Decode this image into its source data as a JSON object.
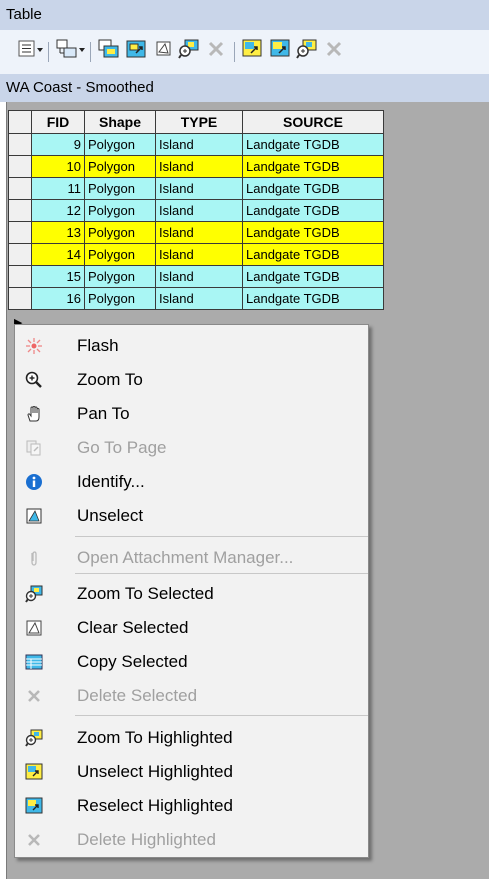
{
  "window": {
    "title": "Table"
  },
  "layer": {
    "name": "WA Coast - Smoothed"
  },
  "table": {
    "columns": [
      "FID",
      "Shape",
      "TYPE",
      "SOURCE"
    ],
    "rows": [
      {
        "fid": "9",
        "shape": "Polygon",
        "type": "Island",
        "source": "Landgate TGDB",
        "highlight": "cyan"
      },
      {
        "fid": "10",
        "shape": "Polygon",
        "type": "Island",
        "source": "Landgate TGDB",
        "highlight": "yellow"
      },
      {
        "fid": "11",
        "shape": "Polygon",
        "type": "Island",
        "source": "Landgate TGDB",
        "highlight": "cyan"
      },
      {
        "fid": "12",
        "shape": "Polygon",
        "type": "Island",
        "source": "Landgate TGDB",
        "highlight": "cyan"
      },
      {
        "fid": "13",
        "shape": "Polygon",
        "type": "Island",
        "source": "Landgate TGDB",
        "highlight": "yellow"
      },
      {
        "fid": "14",
        "shape": "Polygon",
        "type": "Island",
        "source": "Landgate TGDB",
        "highlight": "yellow"
      },
      {
        "fid": "15",
        "shape": "Polygon",
        "type": "Island",
        "source": "Landgate TGDB",
        "highlight": "cyan"
      },
      {
        "fid": "16",
        "shape": "Polygon",
        "type": "Island",
        "source": "Landgate TGDB",
        "highlight": "cyan"
      }
    ]
  },
  "colors": {
    "cyan": "#a9f6f4",
    "yellow": "#ffff00",
    "header_bg": "#c9d5e9"
  },
  "context_menu": {
    "items": [
      {
        "label": "Flash",
        "icon": "flash-icon",
        "enabled": true
      },
      {
        "label": "Zoom To",
        "icon": "zoom-to-icon",
        "enabled": true
      },
      {
        "label": "Pan To",
        "icon": "pan-hand-icon",
        "enabled": true
      },
      {
        "label": "Go To Page",
        "icon": "go-to-page-icon",
        "enabled": false
      },
      {
        "label": "Identify...",
        "icon": "identify-icon",
        "enabled": true
      },
      {
        "label": "Unselect",
        "icon": "unselect-icon",
        "enabled": true
      },
      {
        "label": "Open Attachment Manager...",
        "icon": "paperclip-icon",
        "enabled": false
      },
      {
        "label": "Zoom To Selected",
        "icon": "zoom-to-selected-icon",
        "enabled": true
      },
      {
        "label": "Clear Selected",
        "icon": "clear-selected-icon",
        "enabled": true
      },
      {
        "label": "Copy Selected",
        "icon": "copy-selected-icon",
        "enabled": true
      },
      {
        "label": "Delete Selected",
        "icon": "delete-icon",
        "enabled": false
      },
      {
        "label": "Zoom To Highlighted",
        "icon": "zoom-to-highlighted-icon",
        "enabled": true
      },
      {
        "label": "Unselect Highlighted",
        "icon": "unselect-highlighted-icon",
        "enabled": true
      },
      {
        "label": "Reselect Highlighted",
        "icon": "reselect-highlighted-icon",
        "enabled": true
      },
      {
        "label": "Delete Highlighted",
        "icon": "delete-icon",
        "enabled": false
      }
    ]
  }
}
